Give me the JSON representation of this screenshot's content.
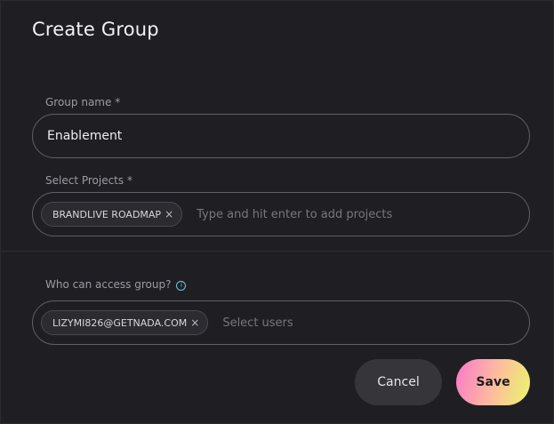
{
  "dialog": {
    "title": "Create Group"
  },
  "group_name": {
    "label": "Group name *",
    "value": "Enablement"
  },
  "projects": {
    "label": "Select Projects *",
    "chips": [
      "BRANDLIVE ROADMAP"
    ],
    "placeholder": "Type and hit enter to add projects"
  },
  "access": {
    "label": "Who can access group?",
    "info_icon": "i",
    "chips": [
      "LIZYMI826@GETNADA.COM"
    ],
    "placeholder": "Select users"
  },
  "actions": {
    "cancel_label": "Cancel",
    "save_label": "Save"
  },
  "icons": {
    "chip_close": "×"
  },
  "colors": {
    "background": "#1f1f23",
    "save_gradient": [
      "#f779c9",
      "#ffb9a0",
      "#e9f76a"
    ],
    "info_accent": "#6fc3e0"
  }
}
